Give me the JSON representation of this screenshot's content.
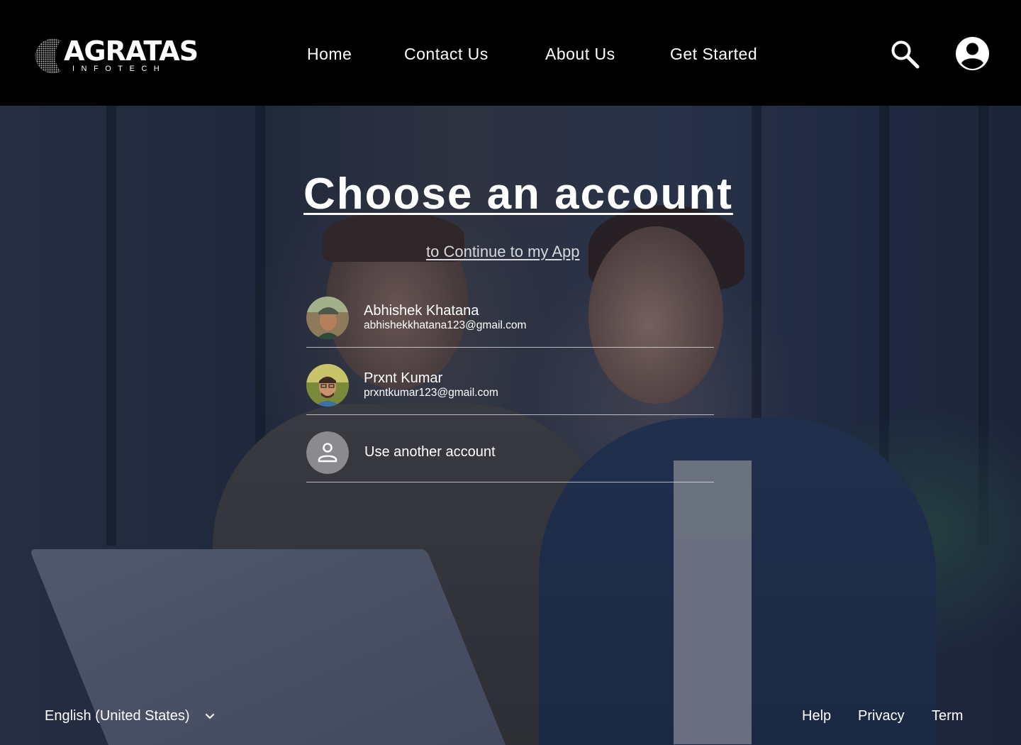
{
  "header": {
    "logo": {
      "wordmark": "AGRATAS",
      "tagline": "INFOTECH"
    },
    "nav": [
      {
        "label": "Home"
      },
      {
        "label": "Contact Us"
      },
      {
        "label": "About Us"
      },
      {
        "label": "Get Started"
      }
    ],
    "icons": {
      "search": "search-icon",
      "profile": "account-circle-icon"
    }
  },
  "main": {
    "title": "Choose an account",
    "subtitle": "to Continue to my App",
    "accounts": [
      {
        "name": "Abhishek Khatana",
        "email": "abhishekkhatana123@gmail.com",
        "avatar": "avatar-photo-icon"
      },
      {
        "name": "Prxnt Kumar",
        "email": "prxntkumar123@gmail.com",
        "avatar": "avatar-photo-icon"
      }
    ],
    "other_account": {
      "label": "Use another account",
      "icon": "person-icon"
    }
  },
  "footer": {
    "language": "English (United States)",
    "links": [
      {
        "label": "Help"
      },
      {
        "label": "Privacy"
      },
      {
        "label": "Term"
      }
    ]
  },
  "colors": {
    "header_bg": "#000000",
    "text": "#ffffff",
    "divider": "#e6e6eb",
    "other_avatar_bg": "#8a8a8f"
  }
}
